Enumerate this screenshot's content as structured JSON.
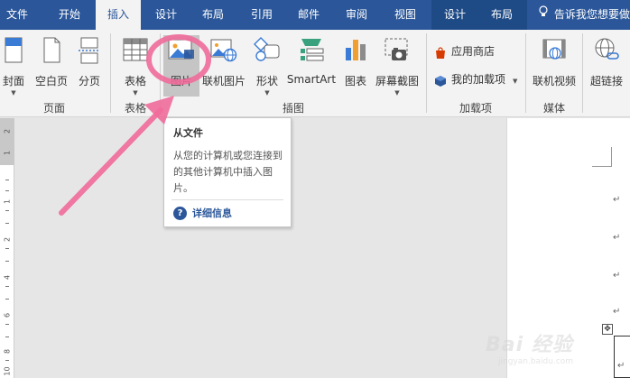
{
  "menubar": {
    "tabs": [
      {
        "label": "文件",
        "active": false
      },
      {
        "label": "开始",
        "active": false
      },
      {
        "label": "插入",
        "active": true
      },
      {
        "label": "设计",
        "active": false
      },
      {
        "label": "布局",
        "active": false
      },
      {
        "label": "引用",
        "active": false
      },
      {
        "label": "邮件",
        "active": false
      },
      {
        "label": "审阅",
        "active": false
      },
      {
        "label": "视图",
        "active": false
      }
    ],
    "context_tabs": [
      "设计",
      "布局"
    ],
    "tell_me": "告诉我您想要做"
  },
  "ribbon": {
    "pages": {
      "cover": "封面",
      "blank": "空白页",
      "break": "分页",
      "group": "页面"
    },
    "tables": {
      "table": "表格",
      "group": "表格"
    },
    "illustrations": {
      "picture": "图片",
      "online_picture": "联机图片",
      "shapes": "形状",
      "smartart": "SmartArt",
      "chart": "图表",
      "screenshot": "屏幕截图",
      "group": "插图"
    },
    "addins": {
      "store": "应用商店",
      "my_addins": "我的加载项",
      "group": "加载项"
    },
    "media": {
      "online_video": "联机视频",
      "group": "媒体"
    },
    "links": {
      "hyperlink": "超链接"
    }
  },
  "tooltip": {
    "title": "从文件",
    "body": "从您的计算机或您连接到的其他计算机中插入图片。",
    "help": "详细信息"
  },
  "ruler": {
    "numbers": [
      "2",
      "1",
      "1",
      "2",
      "4",
      "6",
      "8",
      "10"
    ]
  },
  "document": {
    "para_mark": "↵"
  },
  "watermark": {
    "main": "Bai 经验",
    "sub": "jingyan.baidu.com"
  },
  "colors": {
    "accent": "#2b579a",
    "annotation": "#f06b9b",
    "ribbon": "#f3f3f3"
  }
}
